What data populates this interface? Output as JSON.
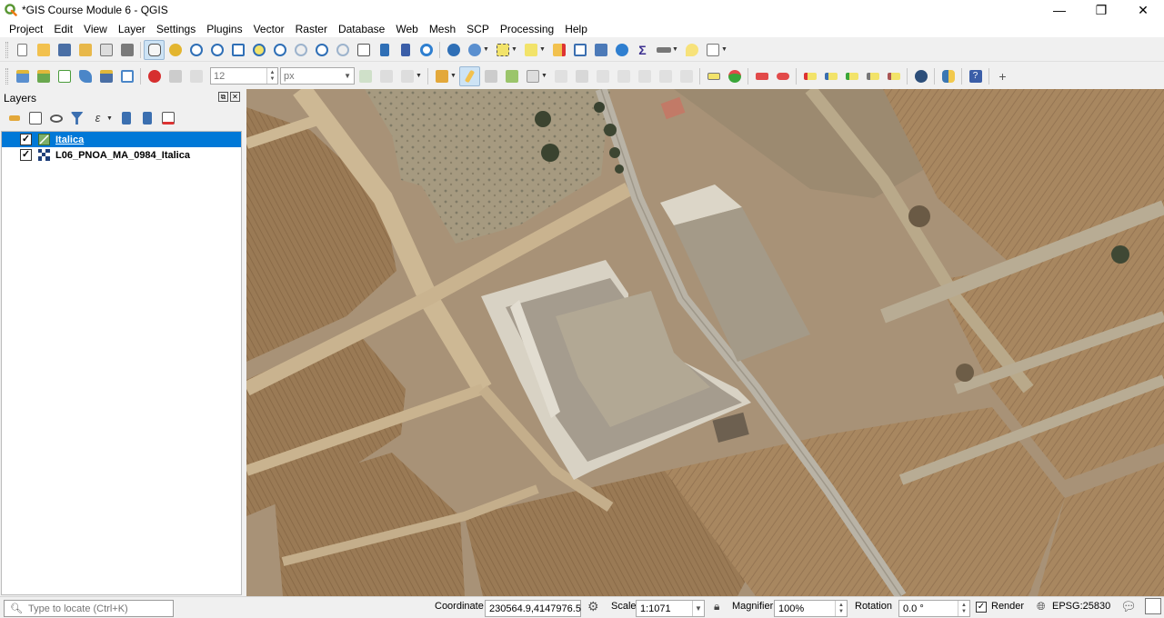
{
  "window": {
    "title": "*GIS Course Module 6 - QGIS",
    "minimize": "—",
    "maximize": "❐",
    "close": "✕"
  },
  "menu": [
    "Project",
    "Edit",
    "View",
    "Layer",
    "Settings",
    "Plugins",
    "Vector",
    "Raster",
    "Database",
    "Web",
    "Mesh",
    "SCP",
    "Processing",
    "Help"
  ],
  "toolbar2": {
    "size_value": "12",
    "unit_value": "px"
  },
  "layers_panel": {
    "title": "Layers",
    "layers": [
      {
        "name": "Italica",
        "checked": true,
        "selected": true
      },
      {
        "name": "L06_PNOA_MA_0984_Italica",
        "checked": true,
        "selected": false
      }
    ]
  },
  "statusbar": {
    "locate_placeholder": "Type to locate (Ctrl+K)",
    "coordinate_label": "Coordinate",
    "coordinate_value": "230564.9,4147976.5",
    "scale_label": "Scale",
    "scale_value": "1:1071",
    "magnifier_label": "Magnifier",
    "magnifier_value": "100%",
    "rotation_label": "Rotation",
    "rotation_value": "0.0 °",
    "render_label": "Render",
    "render_checked": true,
    "crs": "EPSG:25830"
  },
  "colors": {
    "selection": "#0078d7",
    "qgis_green": "#589632"
  }
}
